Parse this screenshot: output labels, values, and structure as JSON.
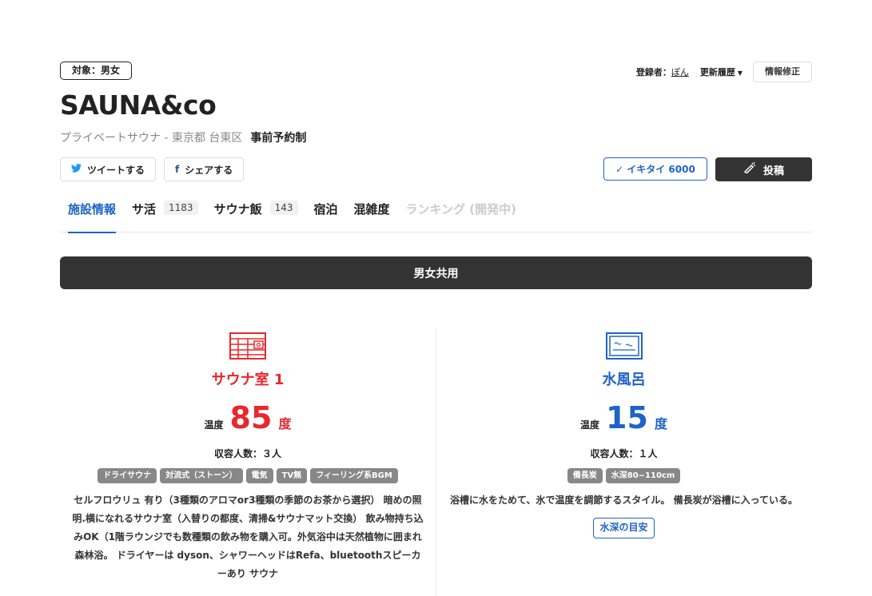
{
  "header": {
    "target_badge": "対象：男女",
    "registrant_label": "登録者：",
    "registrant_name": "ぽん",
    "history_label": "更新履歴",
    "edit_label": "情報修正"
  },
  "facility": {
    "name": "SAUNA&co",
    "category_location": "プライベートサウナ - 東京都 台東区",
    "reservation": "事前予約制"
  },
  "share": {
    "tweet_label": "ツイートする",
    "facebook_label": "シェアする"
  },
  "actions": {
    "ikitai_label": "イキタイ 6000",
    "post_label": "投稿"
  },
  "tabs": [
    {
      "label": "施設情報",
      "count": ""
    },
    {
      "label": "サ活",
      "count": "1183"
    },
    {
      "label": "サウナ飯",
      "count": "143"
    },
    {
      "label": "宿泊",
      "count": ""
    },
    {
      "label": "混雑度",
      "count": ""
    },
    {
      "label": "ランキング (開発中)",
      "count": ""
    }
  ],
  "gender_section": "男女共用",
  "sauna": {
    "title": "サウナ室 1",
    "temp_label": "温度",
    "temp_value": "85",
    "temp_unit": "度",
    "capacity": "収容人数：３人",
    "tags": [
      "ドライサウナ",
      "対流式（ストーン）",
      "電気",
      "TV無",
      "フィーリング系BGM"
    ],
    "description": "セルフロウリュ 有り（3種類のアロマor3種類の季節のお茶から選択） 暗めの照明.横になれるサウナ室（入替りの都度、清掃&サウナマット交換） 飲み物持ち込みOK（1階ラウンジでも数種類の飲み物を購入可。外気浴中は天然植物に囲まれ森林浴。 ドライヤーは dyson、シャワーヘッドはRefa、bluetoothスピーカーあり サウナ"
  },
  "water": {
    "title": "水風呂",
    "temp_label": "温度",
    "temp_value": "15",
    "temp_unit": "度",
    "capacity": "収容人数：１人",
    "tags": [
      "備長炭",
      "水深80~110cm"
    ],
    "description": "浴槽に水をためて、氷で温度を調節するスタイル。 備長炭が浴槽に入っている。",
    "depth_button": "水深の目安"
  },
  "colors": {
    "accent_blue": "#1e63c8",
    "sauna_red": "#e8282c",
    "dark": "#333333",
    "tag_gray": "#888888"
  }
}
